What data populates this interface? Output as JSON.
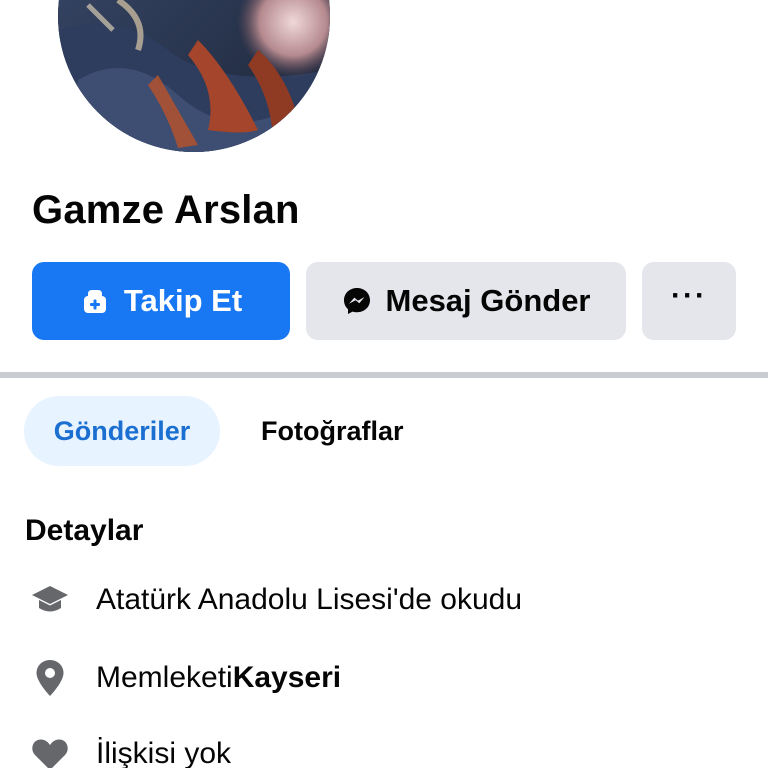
{
  "profile": {
    "name": "Gamze Arslan"
  },
  "actions": {
    "follow_label": "Takip Et",
    "message_label": "Mesaj Gönder",
    "more_label": "···"
  },
  "tabs": [
    {
      "label": "Gönderiler",
      "active": true
    },
    {
      "label": "Fotoğraflar",
      "active": false
    }
  ],
  "details": {
    "title": "Detaylar",
    "items": [
      {
        "icon": "graduation-cap-icon",
        "text": "Atatürk Anadolu Lisesi'de okudu"
      },
      {
        "icon": "location-pin-icon",
        "prefix": "Memleketi ",
        "bold": "Kayseri"
      },
      {
        "icon": "heart-icon",
        "text": "İlişkisi yok"
      }
    ]
  },
  "colors": {
    "primary": "#1877f2",
    "secondary_button": "#e4e6eb",
    "active_tab_bg": "#e7f3ff",
    "active_tab_text": "#1b6fd1",
    "icon_gray": "#65676b",
    "divider": "#c9ccd1"
  }
}
